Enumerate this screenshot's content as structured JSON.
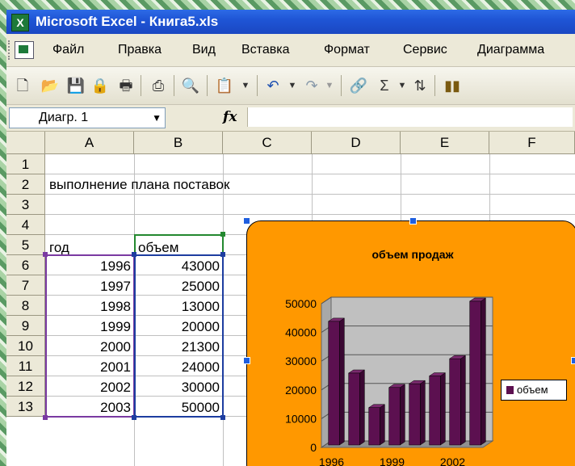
{
  "window": {
    "title": "Microsoft Excel - Книга5.xls",
    "app_icon": "excel-icon"
  },
  "menu": {
    "items": [
      {
        "label": "Файл"
      },
      {
        "label": "Правка"
      },
      {
        "label": "Вид"
      },
      {
        "label": "Вставка"
      },
      {
        "label": "Формат"
      },
      {
        "label": "Сервис"
      },
      {
        "label": "Диаграмма"
      }
    ]
  },
  "toolbar": {
    "icons": [
      "new-icon",
      "open-icon",
      "save-icon",
      "permission-icon",
      "print-preview-icon",
      "print-icon",
      "research-icon",
      "paste-icon",
      "undo-icon",
      "redo-icon",
      "hyperlink-icon",
      "autosum-icon",
      "sort-asc-icon",
      "chart-wizard-icon"
    ],
    "autosum_glyph": "Σ"
  },
  "formula_bar": {
    "name_box": "Диагр. 1",
    "fx_label": "fx",
    "formula": ""
  },
  "columns": [
    "A",
    "B",
    "C",
    "D",
    "E",
    "F"
  ],
  "rows": [
    "1",
    "2",
    "3",
    "4",
    "5",
    "6",
    "7",
    "8",
    "9",
    "10",
    "11",
    "12",
    "13"
  ],
  "cells": {
    "A2": "выполнение плана поставок",
    "A4": "год",
    "B4": "объем",
    "A5": "1996",
    "B5": "43000",
    "A6": "1997",
    "B6": "25000",
    "A7": "1998",
    "B7": "13000",
    "A8": "1999",
    "B8": "20000",
    "A9": "2000",
    "B9": "21300",
    "A10": "2001",
    "B10": "24000",
    "A11": "2002",
    "B11": "30000",
    "A12": "2003",
    "B12": "50000"
  },
  "colors": {
    "chart_bg": "#ff9800",
    "bar": "#5c1050",
    "plot_wall": "#c0c0c0"
  },
  "chart_data": {
    "type": "bar",
    "title": "объем продаж",
    "categories": [
      "1996",
      "1997",
      "1998",
      "1999",
      "2000",
      "2001",
      "2002",
      "2003"
    ],
    "series": [
      {
        "name": "объем",
        "values": [
          43000,
          25000,
          13000,
          20000,
          21300,
          24000,
          30000,
          50000
        ]
      }
    ],
    "x_tick_labels": [
      "1996",
      "1999",
      "2002"
    ],
    "y_ticks": [
      "0",
      "10000",
      "20000",
      "30000",
      "40000",
      "50000"
    ],
    "ylim": [
      0,
      50000
    ],
    "legend": "right",
    "three_d": true
  }
}
